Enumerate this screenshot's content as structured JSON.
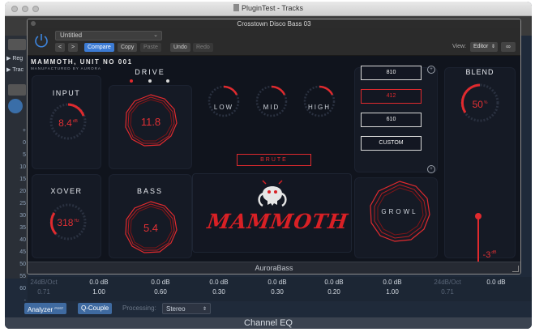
{
  "host": {
    "window_title": "PluginTest - Tracks",
    "sidebar_rows": [
      "Reg",
      "Trac"
    ],
    "db_scale": [
      "+",
      "0",
      "5",
      "10",
      "15",
      "20",
      "25",
      "30",
      "35",
      "40",
      "45",
      "50",
      "55",
      "60",
      "-"
    ],
    "eq_columns": [
      {
        "v1": "24dB/Oct",
        "v2": "0.71",
        "dim": true
      },
      {
        "v1": "0.0 dB",
        "v2": "1.00",
        "dim": false
      },
      {
        "v1": "0.0 dB",
        "v2": "0.60",
        "dim": false
      },
      {
        "v1": "0.0 dB",
        "v2": "0.30",
        "dim": false
      },
      {
        "v1": "0.0 dB",
        "v2": "0.30",
        "dim": false
      },
      {
        "v1": "0.0 dB",
        "v2": "0.20",
        "dim": false
      },
      {
        "v1": "0.0 dB",
        "v2": "1.00",
        "dim": false
      },
      {
        "v1": "24dB/Oct",
        "v2": "0.71",
        "dim": true
      },
      {
        "v1": "0.0 dB",
        "v2": "",
        "dim": false
      }
    ],
    "analyzer_label": "Analyzer",
    "analyzer_badge": "POST",
    "qcouple_label": "Q-Couple",
    "processing_label": "Processing:",
    "processing_value": "Stereo",
    "eq_name": "Channel EQ"
  },
  "plugin": {
    "window_title": "Crosstown Disco Bass 03",
    "preset_name": "Untitled",
    "nav_prev": "<",
    "nav_next": ">",
    "compare_label": "Compare",
    "copy_label": "Copy",
    "paste_label": "Paste",
    "undo_label": "Undo",
    "redo_label": "Redo",
    "view_label": "View:",
    "view_value": "Editor",
    "footer_name": "AuroraBass"
  },
  "mammoth": {
    "brand": "MAMMOTH, UNIT NO 001",
    "brand_sub": "MANUFACTURED BY AURORA",
    "input": {
      "label": "INPUT",
      "value": "8.4",
      "unit": "dB"
    },
    "xover": {
      "label": "XOVER",
      "value": "318",
      "unit": "Hz"
    },
    "drive": {
      "label": "DRIVE",
      "value": "11.8"
    },
    "bass": {
      "label": "BASS",
      "value": "5.4"
    },
    "eq": {
      "low": "LOW",
      "mid": "MID",
      "high": "HIGH"
    },
    "brute_label": "BRUTE",
    "logo_text": "MAMMOTH",
    "cabinets": [
      "810",
      "412",
      "610",
      "CUSTOM"
    ],
    "cabinet_selected": "412",
    "growl_label": "GROWL",
    "blend": {
      "label": "BLEND",
      "value": "50",
      "unit": "%"
    },
    "output": {
      "value": "-3",
      "unit": "dB",
      "level": 0.75
    }
  },
  "colors": {
    "accent": "#e02a2e",
    "panel": "#151a25",
    "background": "#10141d"
  }
}
